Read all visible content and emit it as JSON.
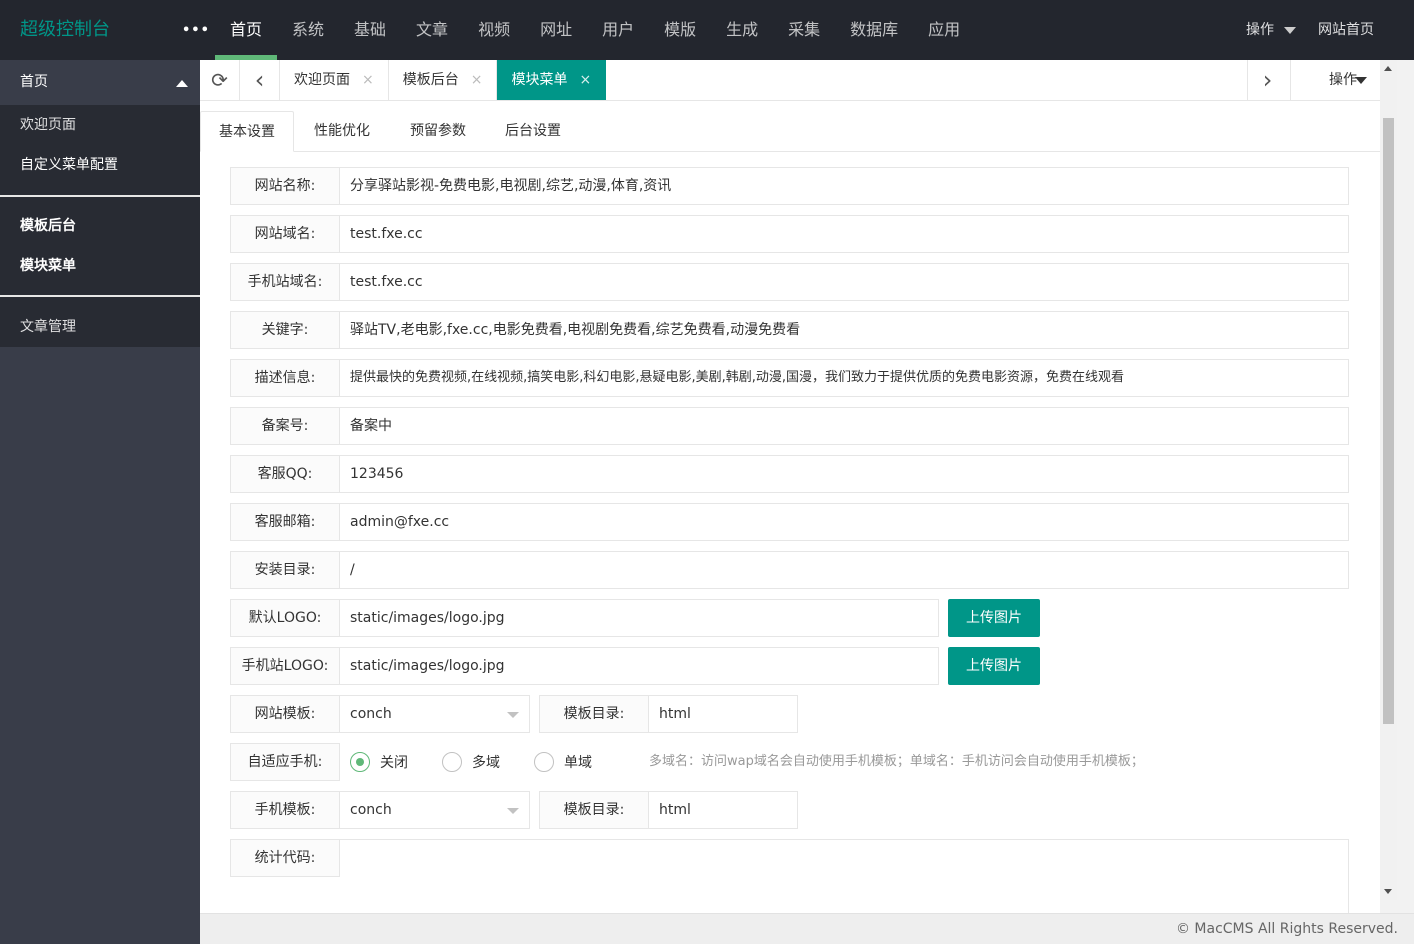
{
  "header": {
    "logo": "超级控制台",
    "more": "•••",
    "nav": [
      "首页",
      "系统",
      "基础",
      "文章",
      "视频",
      "网址",
      "用户",
      "模版",
      "生成",
      "采集",
      "数据库",
      "应用"
    ],
    "active_nav": "首页",
    "ops": "操作",
    "site_home": "网站首页"
  },
  "sidebar": {
    "group1_title": "首页",
    "group1_items": [
      "欢迎页面",
      "自定义菜单配置"
    ],
    "group2_items": [
      "模板后台",
      "模块菜单"
    ],
    "group3_items": [
      "文章管理"
    ]
  },
  "tabbar": {
    "refresh_icon": "⟳",
    "prev_icon": "‹",
    "next_icon": "›",
    "close_icon": "×",
    "tabs": [
      "欢迎页面",
      "模板后台",
      "模块菜单"
    ],
    "active_tab": "模块菜单",
    "ops": "操作"
  },
  "subtabs": [
    "基本设置",
    "性能优化",
    "预留参数",
    "后台设置"
  ],
  "form": {
    "site_name": {
      "label": "网站名称:",
      "value": "分享驿站影视-免费电影,电视剧,综艺,动漫,体育,资讯"
    },
    "site_domain": {
      "label": "网站域名:",
      "value": "test.fxe.cc"
    },
    "mobile_domain": {
      "label": "手机站域名:",
      "value": "test.fxe.cc"
    },
    "keywords": {
      "label": "关键字:",
      "value": "驿站TV,老电影,fxe.cc,电影免费看,电视剧免费看,综艺免费看,动漫免费看"
    },
    "description": {
      "label": "描述信息:",
      "value": "提供最快的免费视频,在线视频,搞笑电影,科幻电影,悬疑电影,美剧,韩剧,动漫,国漫，我们致力于提供优质的免费电影资源，免费在线观看"
    },
    "icp": {
      "label": "备案号:",
      "value": "备案中"
    },
    "qq": {
      "label": "客服QQ:",
      "value": "123456"
    },
    "email": {
      "label": "客服邮箱:",
      "value": "admin@fxe.cc"
    },
    "install_dir": {
      "label": "安装目录:",
      "value": "/"
    },
    "logo": {
      "label": "默认LOGO:",
      "value": "static/images/logo.jpg",
      "button": "上传图片"
    },
    "mobile_logo": {
      "label": "手机站LOGO:",
      "value": "static/images/logo.jpg",
      "button": "上传图片"
    },
    "template": {
      "label": "网站模板:",
      "value": "conch",
      "dir_label": "模板目录:",
      "dir_value": "html"
    },
    "adaptive": {
      "label": "自适应手机:",
      "options": [
        "关闭",
        "多域",
        "单域"
      ],
      "selected": "关闭",
      "hint": "多域名：访问wap域名会自动使用手机模板；单域名：手机访问会自动使用手机模板；"
    },
    "mobile_template": {
      "label": "手机模板:",
      "value": "conch",
      "dir_label": "模板目录:",
      "dir_value": "html"
    },
    "stats_code": {
      "label": "统计代码:",
      "value": ""
    }
  },
  "footer": "© MacCMS All Rights Reserved.",
  "colors": {
    "accent": "#009688",
    "header_bg": "#23262e",
    "sidebar_bg": "#393d49",
    "active_underline": "#5fb878"
  }
}
